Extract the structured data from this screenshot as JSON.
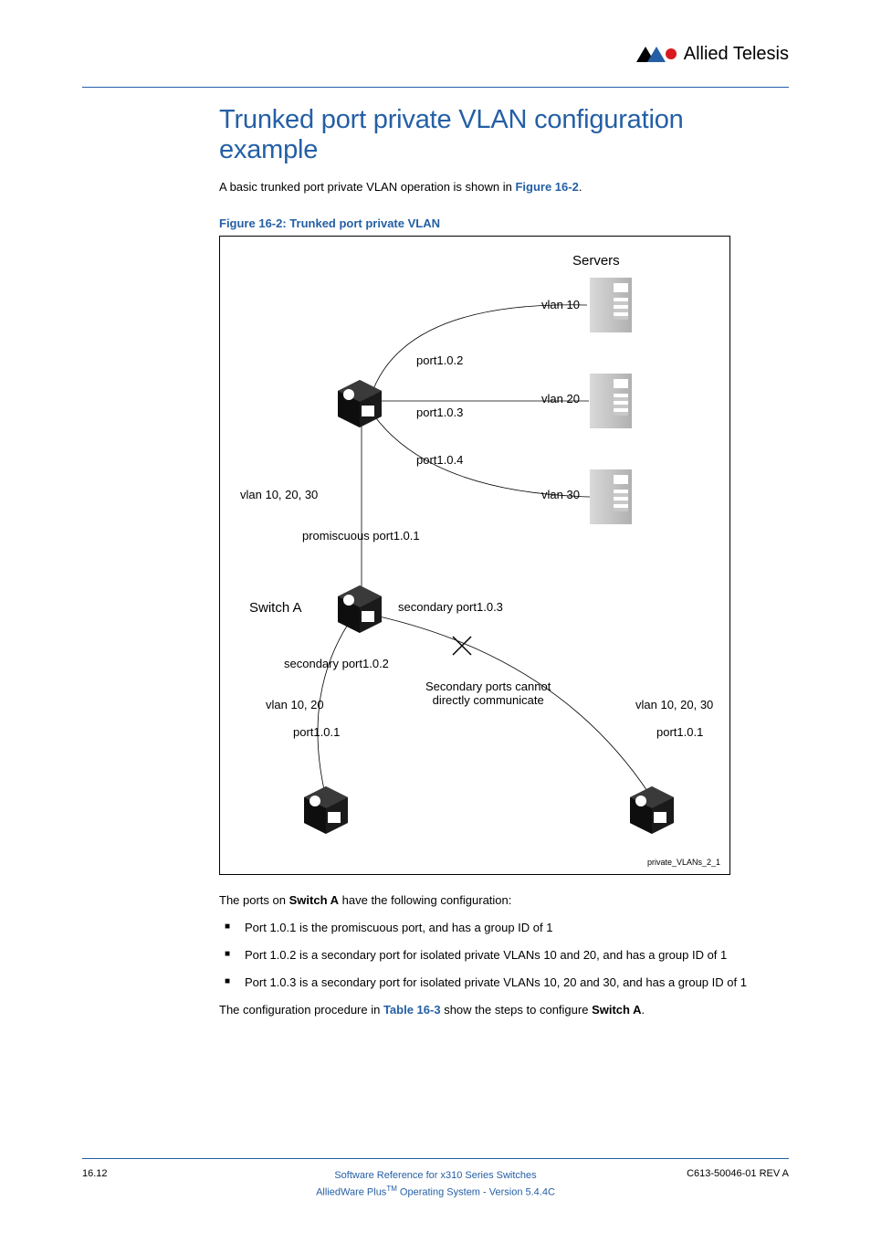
{
  "header": {
    "brand": "Allied Telesis"
  },
  "title": "Trunked port private VLAN configuration example",
  "intro_before": "A basic trunked port private VLAN operation is shown in ",
  "intro_link": "Figure 16-2",
  "intro_after": ".",
  "figure_caption": "Figure 16-2: Trunked port private VLAN",
  "figure": {
    "servers_label": "Servers",
    "vlan10": "vlan 10",
    "vlan20": "vlan 20",
    "vlan30": "vlan 30",
    "port102": "port1.0.2",
    "port103": "port1.0.3",
    "port104": "port1.0.4",
    "vlan102030_left": "vlan 10, 20, 30",
    "promiscuous": "promiscuous port1.0.1",
    "switchA": "Switch A",
    "secondary103": "secondary port1.0.3",
    "secondary102": "secondary port1.0.2",
    "note": "Secondary ports cannot\ndirectly communicate",
    "vlan1020_left": "vlan 10, 20",
    "vlan102030_right": "vlan 10, 20, 30",
    "port101_left": "port1.0.1",
    "port101_right": "port1.0.1",
    "credit": "private_VLANs_2_1"
  },
  "after": {
    "p1_before": "The ports on ",
    "p1_bold": "Switch A",
    "p1_after": " have the following configuration:",
    "bullets": [
      "Port 1.0.1 is the promiscuous port, and has a group ID of 1",
      "Port 1.0.2 is a secondary port for isolated private VLANs 10 and 20, and has a group ID of 1",
      "Port 1.0.3 is a secondary port for isolated private VLANs 10, 20 and 30, and has a group ID of 1"
    ],
    "p2_before": "The configuration procedure in ",
    "p2_link": "Table 16-3",
    "p2_mid": " show the steps to configure ",
    "p2_bold": "Switch A",
    "p2_after": "."
  },
  "footer": {
    "page": "16.12",
    "line1": "Software Reference for x310 Series Switches",
    "line2_a": "AlliedWare Plus",
    "line2_tm": "TM",
    "line2_b": " Operating System  - Version 5.4.4C",
    "rev": "C613-50046-01 REV A"
  }
}
